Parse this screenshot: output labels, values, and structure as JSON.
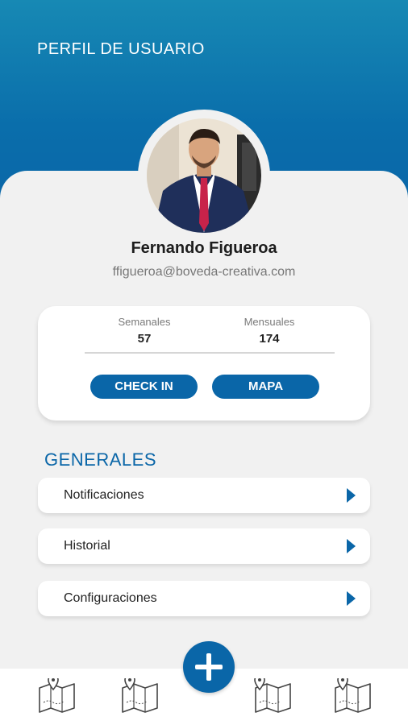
{
  "header": {
    "title": "PERFIL DE USUARIO"
  },
  "profile": {
    "name": "Fernando Figueroa",
    "email": "ffigueroa@boveda-creativa.com",
    "avatar_icon": "user-photo"
  },
  "stats": {
    "weekly_label": "Semanales",
    "weekly_value": "57",
    "monthly_label": "Mensuales",
    "monthly_value": "174",
    "checkin_label": "CHECK IN",
    "map_label": "MAPA"
  },
  "section": {
    "title": "GENERALES"
  },
  "menu": [
    {
      "label": "Notificaciones",
      "icon": "caret-right-icon"
    },
    {
      "label": "Historial",
      "icon": "caret-right-icon"
    },
    {
      "label": "Configuraciones",
      "icon": "caret-right-icon"
    }
  ],
  "bottom_nav": {
    "icons": [
      "map-pin-icon",
      "map-pin-icon",
      "map-pin-icon",
      "map-pin-icon"
    ],
    "fab_icon": "plus-icon"
  },
  "colors": {
    "primary": "#0a66a8",
    "header_top": "#1789b4",
    "background": "#f1f1f1"
  }
}
